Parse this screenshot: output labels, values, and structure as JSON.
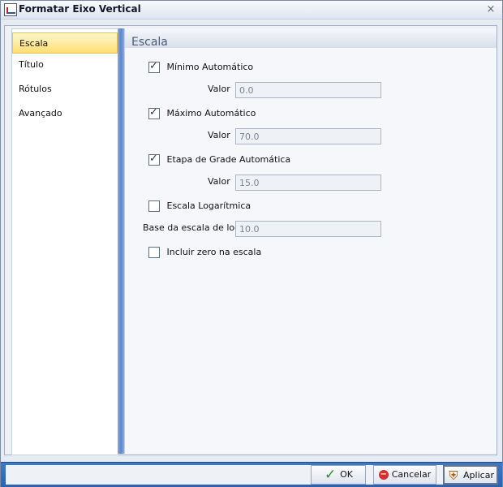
{
  "window": {
    "title": "Formatar Eixo Vertical",
    "close_icon": "×"
  },
  "sidebar": {
    "items": [
      {
        "label": "Escala",
        "selected": true
      },
      {
        "label": "Título"
      },
      {
        "label": "Rótulos"
      },
      {
        "label": "Avançado"
      }
    ]
  },
  "main": {
    "section_title": "Escala",
    "min_auto": {
      "label": "Mínimo Automático",
      "checked": true
    },
    "min_value": {
      "label": "Valor",
      "value": "0.0"
    },
    "max_auto": {
      "label": "Máximo Automático",
      "checked": true
    },
    "max_value": {
      "label": "Valor",
      "value": "70.0"
    },
    "grid_auto": {
      "label": "Etapa de Grade Automática",
      "checked": true
    },
    "grid_value": {
      "label": "Valor",
      "value": "15.0"
    },
    "log_scale": {
      "label": "Escala Logarítmica",
      "checked": false
    },
    "log_base": {
      "label": "Base da escala de log",
      "value": "10.0"
    },
    "include_zero": {
      "label": "Incluir zero na escala",
      "checked": false
    }
  },
  "footer": {
    "ok": "OK",
    "cancel": "Cancelar",
    "apply": "Aplicar"
  },
  "icons": {
    "ok": "check-icon",
    "cancel": "no-entry-icon",
    "apply": "stamp-icon"
  }
}
